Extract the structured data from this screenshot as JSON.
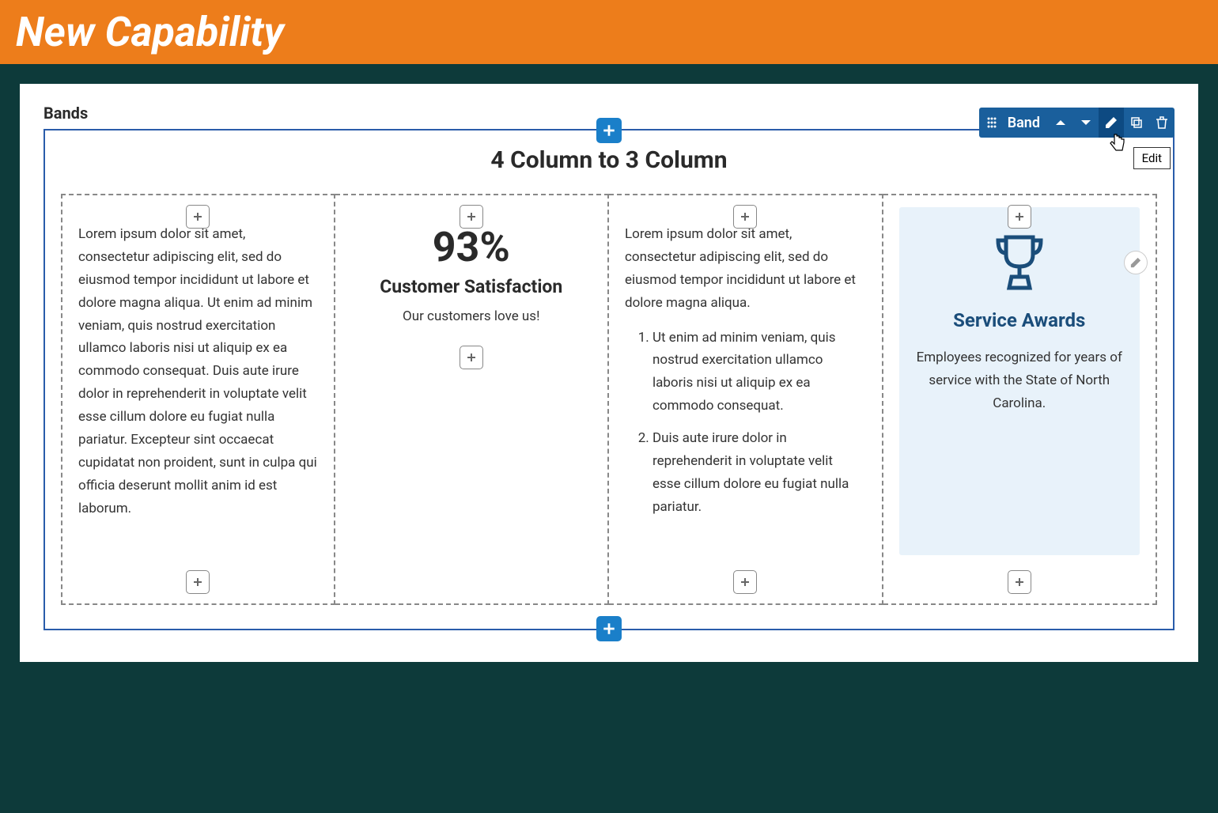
{
  "header": {
    "title": "New Capability"
  },
  "section_label": "Bands",
  "toolbar": {
    "label": "Band",
    "tooltip": "Edit"
  },
  "band": {
    "title": "4 Column to 3 Column"
  },
  "col1": {
    "text": "Lorem ipsum dolor sit amet, consectetur adipiscing elit, sed do eiusmod tempor incididunt ut labore et dolore magna aliqua. Ut enim ad minim veniam, quis nostrud exercitation ullamco laboris nisi ut aliquip ex ea commodo consequat. Duis aute irure dolor in reprehenderit in voluptate velit esse cillum dolore eu fugiat nulla pariatur. Excepteur sint occaecat cupidatat non proident, sunt in culpa qui officia deserunt mollit anim id est laborum."
  },
  "col2": {
    "stat": "93%",
    "label": "Customer Satisfaction",
    "sub": "Our customers love us!"
  },
  "col3": {
    "intro": "Lorem ipsum dolor sit amet, consectetur adipiscing elit, sed do eiusmod tempor incididunt ut labore et dolore magna aliqua.",
    "items": [
      "Ut enim ad minim veniam, quis nostrud exercitation ullamco laboris nisi ut aliquip ex ea commodo consequat.",
      "Duis aute irure dolor in reprehenderit in voluptate velit esse cillum dolore eu fugiat nulla pariatur."
    ]
  },
  "col4": {
    "title": "Service Awards",
    "body": "Employees recognized for years of service with the State of North Carolina."
  }
}
